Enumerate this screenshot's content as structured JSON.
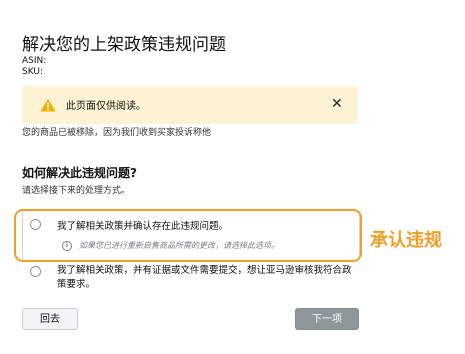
{
  "page": {
    "title": "解决您的上架政策违规问题",
    "asin_label": "ASIN:",
    "sku_label": "SKU:"
  },
  "notice": {
    "icon": "warning-icon",
    "text": "此页面仅供阅读。",
    "close_glyph": "✕"
  },
  "removed_text": "您的商品已被移除，因为我们收到买家投诉称他",
  "question": {
    "heading": "如何解决此违规问题?",
    "sub": "请选择接下来的处理方式。"
  },
  "options": [
    {
      "label": "我了解相关政策并确认存在此违规问题。",
      "hint": "如果您已进行重新启售商品所需的更改，请选择此选项。",
      "hint_icon": "info-icon"
    },
    {
      "label": "我了解相关政策，并有证据或文件需要提交，想让亚马逊审核我符合政策要求。"
    }
  ],
  "callout": "承认违规",
  "buttons": {
    "back": "回去",
    "next": "下一项"
  },
  "colors": {
    "notice_bg": "#fdf3d4",
    "warning": "#f0b400",
    "highlight": "#f0a028",
    "next_button": "#8f9699"
  }
}
